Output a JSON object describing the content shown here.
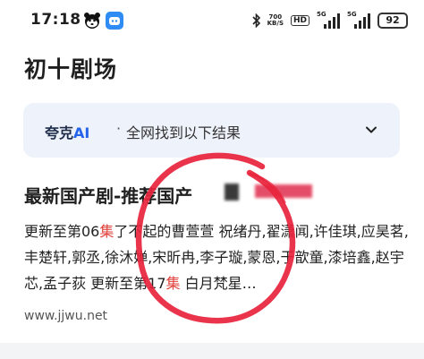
{
  "status": {
    "time": "17:18",
    "speed_value": "700",
    "speed_unit": "KB/S",
    "hd_label": "HD",
    "sig1_label": "5G",
    "sig2_label": "5G",
    "battery": "92"
  },
  "page": {
    "title": "初十剧场"
  },
  "ai_bar": {
    "brand": "夸克",
    "ai": "AI",
    "separator": "·",
    "subtitle": "全网找到以下结果"
  },
  "result": {
    "title": "最新国产剧-推荐国产",
    "snippet_parts": {
      "p1": "更新至第06",
      "p2": "集",
      "p3": "了不起的曹萱萱 祝绪丹,翟潇闻,许佳琪,应昊茗,丰楚轩,郭丞,徐沐婵,宋昕冉,李子璇,蒙恩,于歆童,漆培鑫,赵宇芯,孟子荻 更新至第17",
      "p4": "集",
      "p5": " 白月梵星…"
    },
    "source": "www.jjwu.net"
  },
  "colors": {
    "ai_blue": "#2563eb",
    "highlight": "#e0413a",
    "ink_red": "#e8233c",
    "card_bg": "#eef3fb"
  },
  "icons": [
    "bear-app-icon",
    "blue-app-icon",
    "bluetooth-icon",
    "chevron-down-icon"
  ]
}
